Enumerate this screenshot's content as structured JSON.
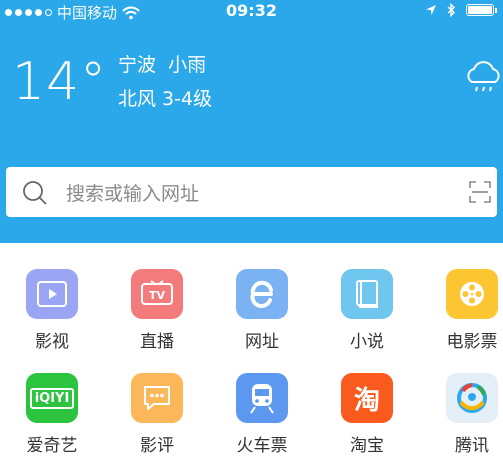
{
  "status_bar": {
    "carrier": "中国移动",
    "time": "09:32"
  },
  "weather": {
    "temperature": "14°",
    "city": "宁波",
    "condition": "小雨",
    "wind": "北风 3-4级"
  },
  "search": {
    "placeholder": "搜索或输入网址"
  },
  "apps": [
    {
      "label": "影视",
      "color": "#9aa6f4",
      "icon": "video-icon"
    },
    {
      "label": "直播",
      "color": "#f47b7b",
      "icon": "tv-icon"
    },
    {
      "label": "网址",
      "color": "#7ab2f3",
      "icon": "browser-e-icon"
    },
    {
      "label": "小说",
      "color": "#6fc6ee",
      "icon": "book-icon"
    },
    {
      "label": "电影票",
      "color": "#fcc532",
      "icon": "film-reel-icon"
    },
    {
      "label": "爱奇艺",
      "color": "#2cc33f",
      "icon": "iqiyi-logo-icon",
      "logo_text": "iQIYI"
    },
    {
      "label": "影评",
      "color": "#fbb75a",
      "icon": "comment-icon"
    },
    {
      "label": "火车票",
      "color": "#5c98f0",
      "icon": "train-icon"
    },
    {
      "label": "淘宝",
      "color": "#fb5a1f",
      "icon": "taobao-logo-icon",
      "logo_text": "淘"
    },
    {
      "label": "腾讯",
      "color": "#e3eef6",
      "icon": "tencent-news-icon"
    }
  ]
}
